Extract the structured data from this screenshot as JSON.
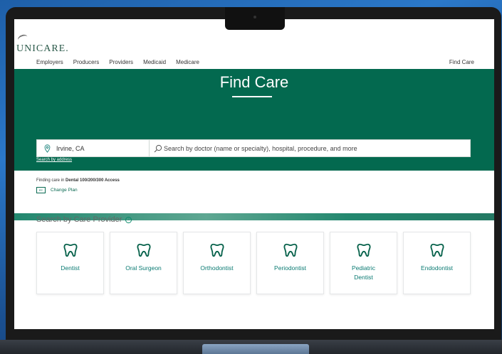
{
  "brand": {
    "name": "UNICARE."
  },
  "nav": {
    "items": [
      "Employers",
      "Producers",
      "Providers",
      "Medicaid",
      "Medicare"
    ],
    "right": "Find Care"
  },
  "hero": {
    "title": "Find Care",
    "location_value": "Irvine, CA",
    "search_placeholder": "Search by doctor (name or specialty), hospital, procedure, and more",
    "address_link": "Search by address"
  },
  "plan": {
    "prefix": "Finding care in ",
    "name": "Dental 100/200/300 Access",
    "change_label": "Change Plan"
  },
  "providers": {
    "title": "Search by Care Provider",
    "items": [
      {
        "label": "Dentist"
      },
      {
        "label": "Oral Surgeon"
      },
      {
        "label": "Orthodontist"
      },
      {
        "label": "Periodontist"
      },
      {
        "label": "Pediatric Dentist"
      },
      {
        "label": "Endodontist"
      }
    ]
  },
  "colors": {
    "brand_green": "#03694f",
    "accent_teal": "#0a7a72"
  }
}
